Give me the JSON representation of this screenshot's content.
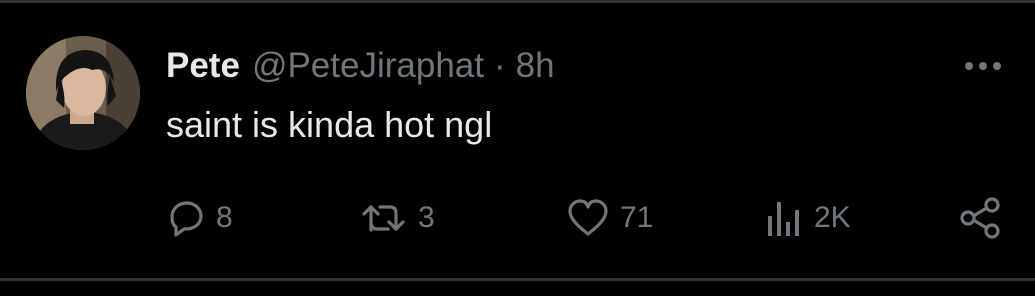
{
  "tweet": {
    "display_name": "Pete",
    "handle": "@PeteJiraphat",
    "separator": "·",
    "timestamp": "8h",
    "text": "saint is kinda hot ngl"
  },
  "actions": {
    "replies": "8",
    "retweets": "3",
    "likes": "71",
    "views": "2K"
  },
  "icons": {
    "more": "more-horizontal-icon",
    "reply": "reply-bubble-icon",
    "retweet": "retweet-arrows-icon",
    "like": "heart-icon",
    "views": "views-bar-chart-icon",
    "share": "share-nodes-icon"
  },
  "colors": {
    "background": "#000000",
    "text_primary": "#e7e9ea",
    "text_secondary": "#71767b",
    "divider": "#2f3336"
  }
}
